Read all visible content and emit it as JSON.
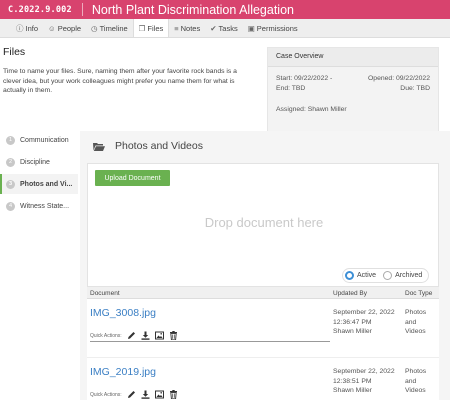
{
  "header": {
    "case_code": "C.2022.9.002",
    "case_title": "North Plant Discrimination Allegation"
  },
  "tabs": [
    {
      "icon": "info-icon",
      "glyph": "ⓘ",
      "label": "Info"
    },
    {
      "icon": "people-icon",
      "glyph": "☺",
      "label": "People"
    },
    {
      "icon": "timeline-icon",
      "glyph": "◷",
      "label": "Timeline"
    },
    {
      "icon": "files-icon",
      "glyph": "❐",
      "label": "Files",
      "active": true
    },
    {
      "icon": "notes-icon",
      "glyph": "≡",
      "label": "Notes"
    },
    {
      "icon": "tasks-icon",
      "glyph": "✔",
      "label": "Tasks"
    },
    {
      "icon": "lock-icon",
      "glyph": "▣",
      "label": "Permissions"
    }
  ],
  "files": {
    "heading": "Files",
    "description": "Time to name your files. Sure, naming them after your favorite rock bands is a clever idea, but your work colleagues might prefer you name them for what is actually in them."
  },
  "overview": {
    "title": "Case Overview",
    "start": "Start: 09/22/2022 -",
    "end": "End: TBD",
    "opened": "Opened: 09/22/2022",
    "due": "Due: TBD",
    "assigned": "Assigned: Shawn Miller"
  },
  "sidebar": {
    "items": [
      {
        "num": "1",
        "label": "Communication"
      },
      {
        "num": "2",
        "label": "Discipline"
      },
      {
        "num": "3",
        "label": "Photos and Vi...",
        "active": true
      },
      {
        "num": "4",
        "label": "Witness State..."
      }
    ]
  },
  "main": {
    "title": "Photos and Videos",
    "upload_label": "Upload Document",
    "drop_text": "Drop document here",
    "filter": {
      "active_label": "Active",
      "archived_label": "Archived",
      "selected": "Active"
    },
    "columns": {
      "document": "Document",
      "updated_by": "Updated By",
      "doc_type": "Doc Type"
    },
    "quick_actions_label": "Quick Actions:",
    "quick_action_icons": [
      "edit-icon",
      "download-icon",
      "image-icon",
      "trash-icon"
    ],
    "documents": [
      {
        "name": "IMG_3008.jpg",
        "updated_date": "September 22, 2022",
        "updated_time": "12:36:47 PM",
        "updated_user": "Shawn Miller",
        "type_l1": "Photos",
        "type_l2": "and",
        "type_l3": "Videos"
      },
      {
        "name": "IMG_2019.jpg",
        "updated_date": "September 22, 2022",
        "updated_time": "12:38:51 PM",
        "updated_user": "Shawn Miller",
        "type_l1": "Photos",
        "type_l2": "and",
        "type_l3": "Videos"
      }
    ]
  },
  "colors": {
    "brand": "#d8436e",
    "accent_green": "#6ab150",
    "link_blue": "#3b7fc4",
    "radio_blue": "#3d8fd6"
  }
}
